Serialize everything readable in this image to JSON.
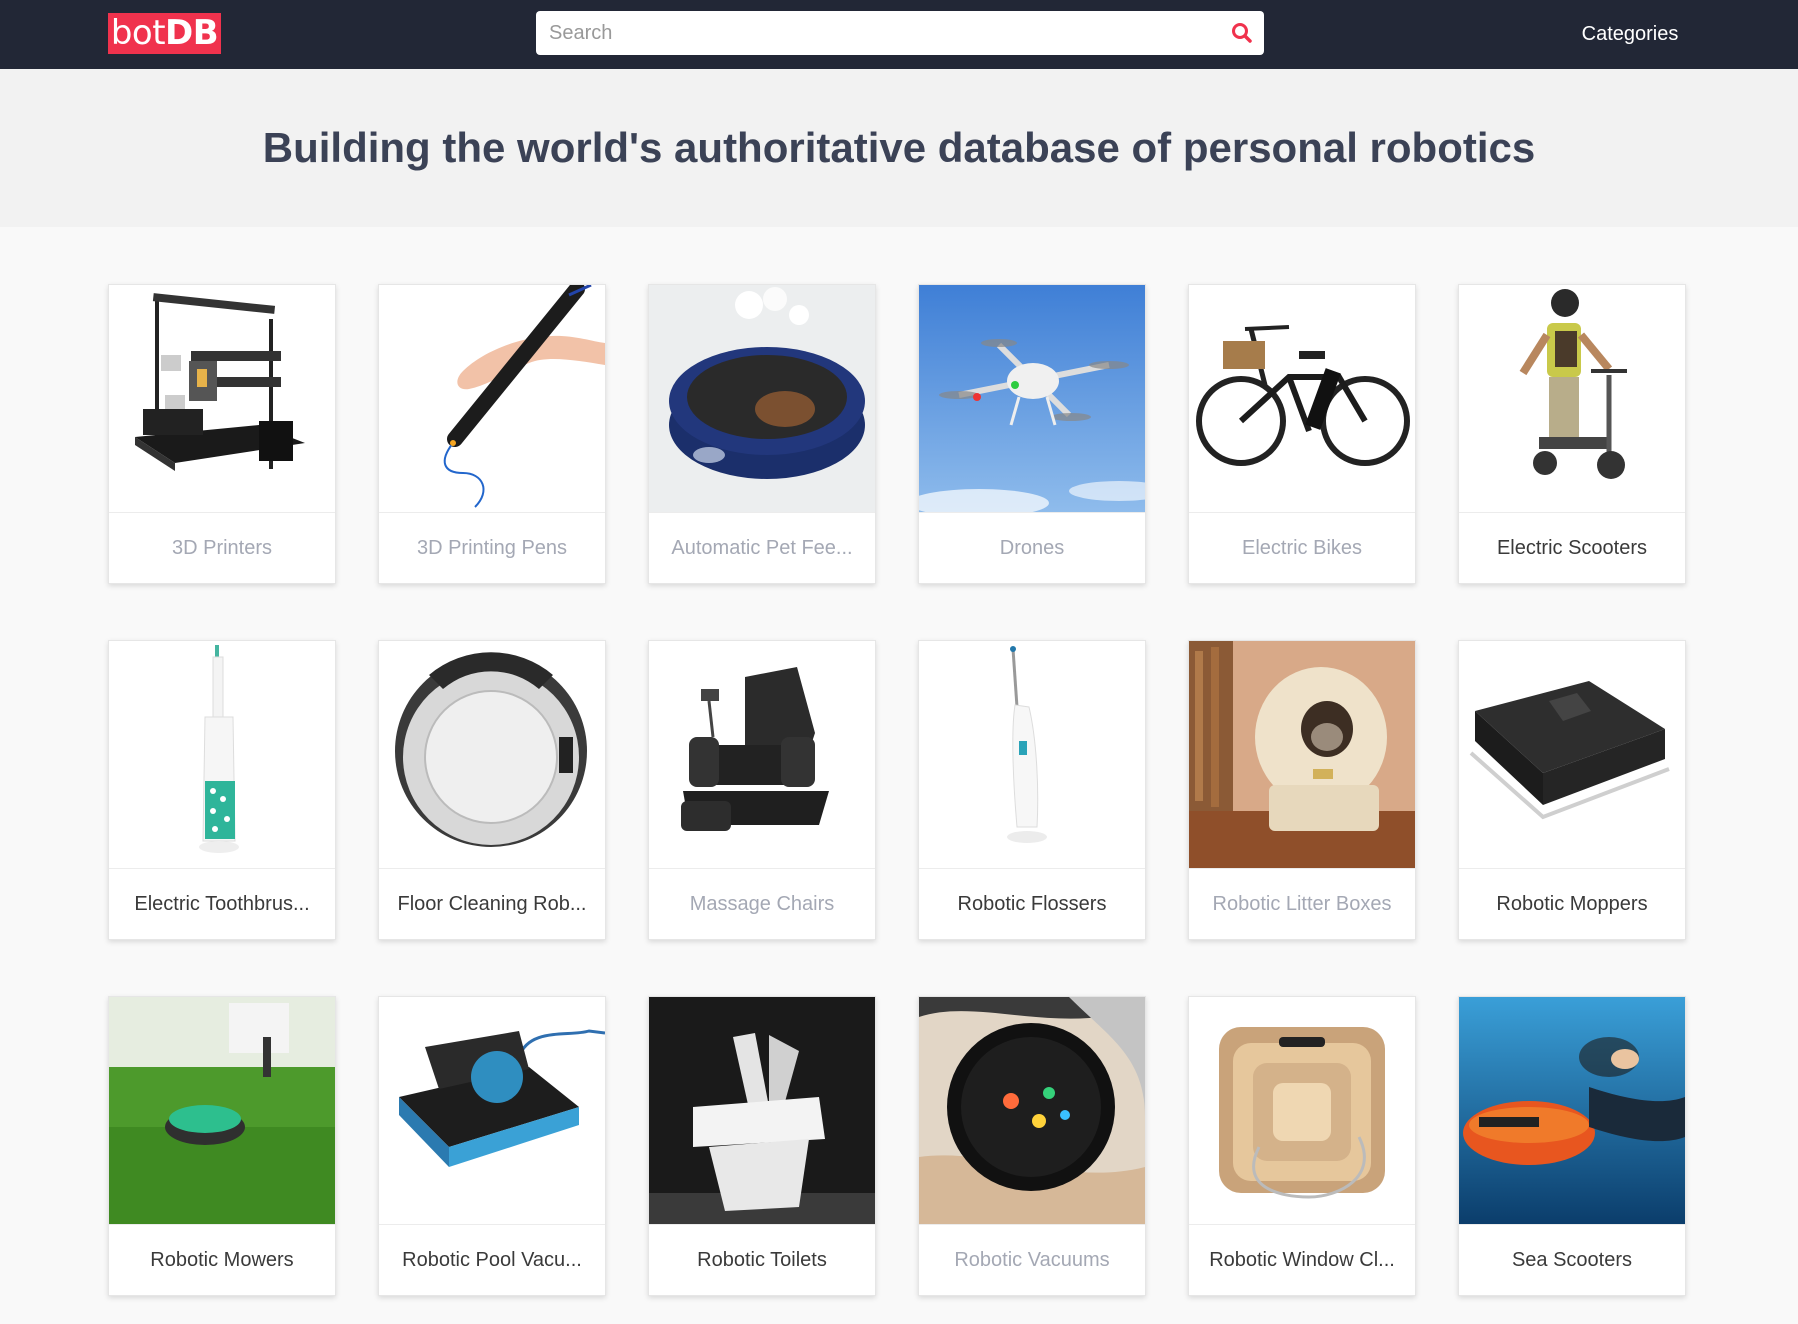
{
  "header": {
    "logo": {
      "light": "bot",
      "bold": "DB"
    },
    "search": {
      "placeholder": "Search",
      "value": ""
    },
    "categories_label": "Categories"
  },
  "hero": {
    "title": "Building the world's authoritative database of personal robotics"
  },
  "categories": [
    {
      "label": "3D Printers",
      "icon": "3d-printer",
      "muted": true
    },
    {
      "label": "3D Printing Pens",
      "icon": "3d-pen",
      "muted": true
    },
    {
      "label": "Automatic Pet Fee...",
      "icon": "pet-feeder",
      "muted": true
    },
    {
      "label": "Drones",
      "icon": "drone",
      "muted": true
    },
    {
      "label": "Electric Bikes",
      "icon": "bike",
      "muted": true
    },
    {
      "label": "Electric Scooters",
      "icon": "scooter",
      "muted": false
    },
    {
      "label": "Electric Toothbrus...",
      "icon": "toothbrush",
      "muted": false
    },
    {
      "label": "Floor Cleaning Rob...",
      "icon": "floor-robot",
      "muted": false
    },
    {
      "label": "Massage Chairs",
      "icon": "massage-chair",
      "muted": true
    },
    {
      "label": "Robotic Flossers",
      "icon": "flosser",
      "muted": false
    },
    {
      "label": "Robotic Litter Boxes",
      "icon": "litter-box",
      "muted": true
    },
    {
      "label": "Robotic Moppers",
      "icon": "mopper",
      "muted": false
    },
    {
      "label": "Robotic Mowers",
      "icon": "mower",
      "muted": false
    },
    {
      "label": "Robotic Pool Vacu...",
      "icon": "pool-vacuum",
      "muted": false
    },
    {
      "label": "Robotic Toilets",
      "icon": "toilet",
      "muted": false
    },
    {
      "label": "Robotic Vacuums",
      "icon": "vacuum",
      "muted": true
    },
    {
      "label": "Robotic Window Cl...",
      "icon": "window-cleaner",
      "muted": false
    },
    {
      "label": "Sea Scooters",
      "icon": "sea-scooter",
      "muted": false
    }
  ],
  "colors": {
    "topbar": "#222736",
    "brand": "#f0324d",
    "hero_bg": "#f2f2f2",
    "hero_text": "#3b4256",
    "muted_label": "#a4a8b4"
  }
}
